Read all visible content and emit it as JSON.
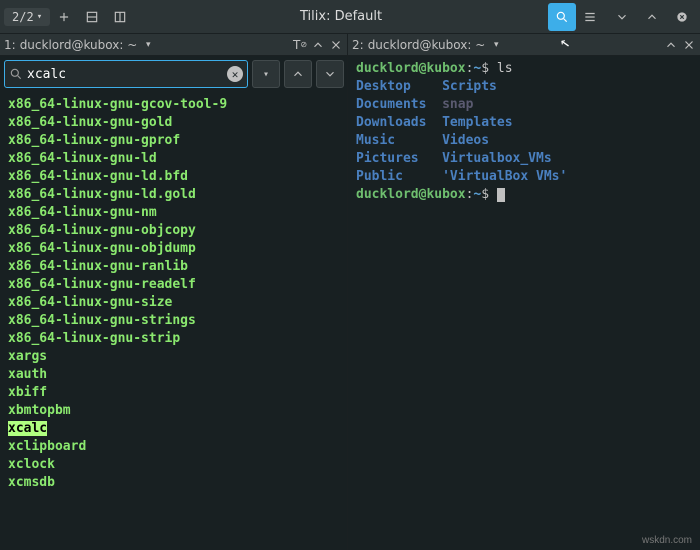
{
  "titlebar": {
    "tab_indicator": "2/2",
    "title": "Tilix: Default"
  },
  "panes": {
    "left": {
      "header_index": "1:",
      "header_text": "ducklord@kubox: ~",
      "search": {
        "value": "xcalc",
        "placeholder": ""
      },
      "results": [
        "x86_64-linux-gnu-gcov-tool-9",
        "x86_64-linux-gnu-gold",
        "x86_64-linux-gnu-gprof",
        "x86_64-linux-gnu-ld",
        "x86_64-linux-gnu-ld.bfd",
        "x86_64-linux-gnu-ld.gold",
        "x86_64-linux-gnu-nm",
        "x86_64-linux-gnu-objcopy",
        "x86_64-linux-gnu-objdump",
        "x86_64-linux-gnu-ranlib",
        "x86_64-linux-gnu-readelf",
        "x86_64-linux-gnu-size",
        "x86_64-linux-gnu-strings",
        "x86_64-linux-gnu-strip",
        "xargs",
        "xauth",
        "xbiff",
        "xbmtopbm",
        "xcalc",
        "xclipboard",
        "xclock",
        "xcmsdb"
      ],
      "highlighted": "xcalc"
    },
    "right": {
      "header_index": "2:",
      "header_text": "ducklord@kubox: ~",
      "prompt": {
        "user": "ducklord@kubox",
        "path": "~",
        "symbol": "$"
      },
      "command": "ls",
      "ls_rows": [
        [
          "Desktop",
          "Scripts"
        ],
        [
          "Documents",
          "snap"
        ],
        [
          "Downloads",
          "Templates"
        ],
        [
          "Music",
          "Videos"
        ],
        [
          "Pictures",
          "Virtualbox_VMs"
        ],
        [
          "Public",
          "'VirtualBox VMs'"
        ]
      ]
    }
  },
  "watermark": "wskdn.com"
}
